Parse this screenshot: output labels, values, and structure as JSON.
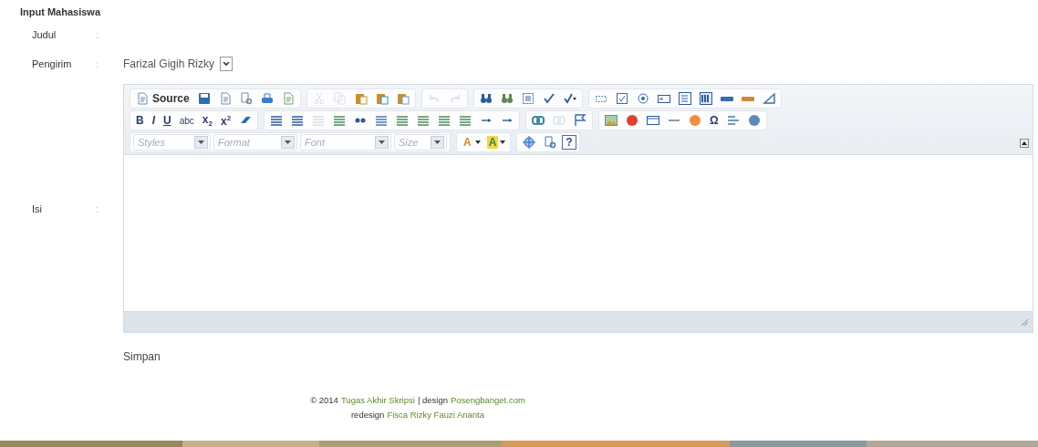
{
  "heading": "Input Mahasiswa",
  "fields": [
    {
      "label": "Judul",
      "separator": ":",
      "kind": "text"
    },
    {
      "label": "Pengirim",
      "separator": ":",
      "kind": "select",
      "value": "Farizal Gigih Rizky"
    },
    {
      "label": "Isi",
      "separator": ":",
      "kind": "editor"
    }
  ],
  "editor": {
    "toolbar": [
      [
        [
          {
            "kind": "icon-text",
            "label": "Source",
            "disabled": false
          },
          {
            "kind": "icon",
            "disabled": false
          },
          {
            "kind": "icon",
            "disabled": false
          },
          {
            "kind": "icon",
            "disabled": false
          },
          {
            "kind": "icon",
            "disabled": false
          },
          {
            "kind": "icon",
            "disabled": false
          }
        ],
        [
          {
            "kind": "icon",
            "disabled": true
          },
          {
            "kind": "icon",
            "disabled": true
          },
          {
            "kind": "icon",
            "disabled": false
          },
          {
            "kind": "icon",
            "disabled": false
          },
          {
            "kind": "icon",
            "disabled": false
          }
        ],
        [
          {
            "kind": "icon",
            "disabled": true
          },
          {
            "kind": "icon",
            "disabled": true
          }
        ],
        [
          {
            "kind": "icon",
            "disabled": false
          },
          {
            "kind": "icon",
            "disabled": false
          },
          {
            "kind": "icon",
            "disabled": false
          },
          {
            "kind": "icon",
            "disabled": false
          },
          {
            "kind": "icon",
            "disabled": false
          }
        ],
        [
          {
            "kind": "icon",
            "disabled": false
          },
          {
            "kind": "icon",
            "disabled": false
          },
          {
            "kind": "icon",
            "disabled": false
          },
          {
            "kind": "icon",
            "disabled": false
          },
          {
            "kind": "icon",
            "disabled": false
          },
          {
            "kind": "icon",
            "disabled": false
          },
          {
            "kind": "icon",
            "disabled": false
          },
          {
            "kind": "icon",
            "disabled": false
          },
          {
            "kind": "icon",
            "disabled": false
          }
        ]
      ],
      [
        [
          {
            "kind": "text",
            "label": "B",
            "disabled": false
          },
          {
            "kind": "text",
            "label": "I",
            "disabled": false
          },
          {
            "kind": "text",
            "label": "U",
            "disabled": false
          },
          {
            "kind": "text",
            "label": "abc",
            "disabled": false
          },
          {
            "kind": "text",
            "label": "x$_{2}$",
            "disabled": false
          },
          {
            "kind": "text",
            "label": "x$^{2}$",
            "disabled": false
          },
          {
            "kind": "icon",
            "disabled": false
          }
        ],
        [
          {
            "kind": "icon",
            "disabled": false
          },
          {
            "kind": "icon",
            "disabled": false
          },
          {
            "kind": "icon",
            "disabled": true
          },
          {
            "kind": "icon",
            "disabled": false
          },
          {
            "kind": "icon",
            "disabled": false
          },
          {
            "kind": "icon",
            "disabled": false
          },
          {
            "kind": "icon",
            "disabled": false
          },
          {
            "kind": "icon",
            "disabled": false
          },
          {
            "kind": "icon",
            "disabled": false
          },
          {
            "kind": "icon",
            "disabled": false
          },
          {
            "kind": "icon",
            "disabled": false
          },
          {
            "kind": "icon",
            "disabled": false
          }
        ],
        [
          {
            "kind": "icon",
            "disabled": false
          },
          {
            "kind": "icon",
            "disabled": true
          },
          {
            "kind": "icon",
            "disabled": false
          }
        ],
        [
          {
            "kind": "icon",
            "disabled": false
          },
          {
            "kind": "icon",
            "disabled": false
          },
          {
            "kind": "icon",
            "disabled": false
          },
          {
            "kind": "icon",
            "disabled": false
          },
          {
            "kind": "icon",
            "disabled": false
          },
          {
            "kind": "text",
            "label": "Ω",
            "disabled": false
          },
          {
            "kind": "icon",
            "disabled": false
          },
          {
            "kind": "icon",
            "disabled": false
          }
        ]
      ],
      [
        [
          {
            "kind": "combo",
            "placeholder": "Styles"
          },
          {
            "kind": "combo",
            "placeholder": "Format"
          },
          {
            "kind": "combo",
            "placeholder": "Font"
          },
          {
            "kind": "combo",
            "placeholder": "Size"
          }
        ],
        [
          {
            "kind": "color",
            "label": "A",
            "color": "#d08a1a"
          },
          {
            "kind": "color",
            "label": "A",
            "color": "#f2d84a"
          }
        ],
        [
          {
            "kind": "icon",
            "disabled": false
          },
          {
            "kind": "icon",
            "disabled": false
          },
          {
            "kind": "text",
            "label": "?",
            "disabled": false
          }
        ]
      ]
    ]
  },
  "save_button": "Simpan",
  "footer": {
    "lines": [
      [
        {
          "text": "© 2014",
          "link": false
        },
        {
          "text": "Tugas Akhir Skripsi",
          "link": true
        },
        {
          "text": "| design",
          "link": false
        },
        {
          "text": "Posengbanget.com",
          "link": true
        }
      ],
      [
        {
          "text": "redesign",
          "link": false
        },
        {
          "text": "Fisca Rizky Fauzi Ananta",
          "link": true
        }
      ]
    ]
  }
}
